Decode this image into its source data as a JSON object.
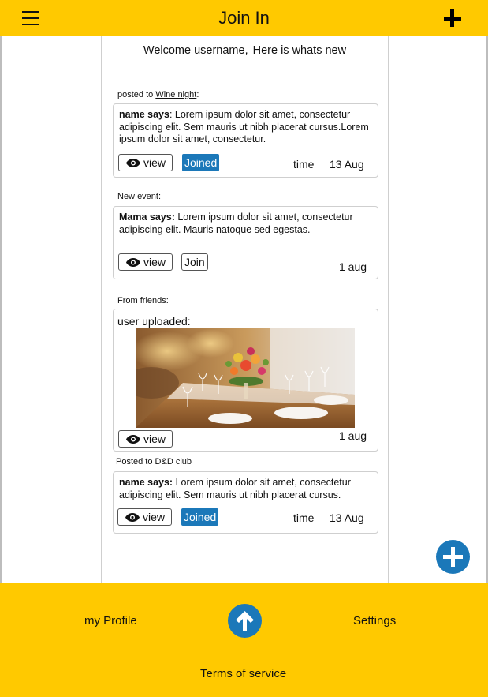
{
  "header": {
    "title": "Join In"
  },
  "feed": {
    "welcome_line1": "Welcome username,",
    "welcome_line2": "Here is whats new",
    "posts": [
      {
        "caption_prefix": "posted to ",
        "caption_link": "Wine night",
        "caption_suffix": ":",
        "author": "name says",
        "text": ": Lorem ipsum dolor sit amet, consectetur adipiscing elit. Sem mauris ut nibh placerat cursus.Lorem ipsum dolor sit amet, consectetur.",
        "view_label": "view",
        "join_label": "Joined",
        "time_label": "time",
        "date": "13 Aug"
      },
      {
        "caption_prefix": "New ",
        "caption_link": "event",
        "caption_suffix": ":",
        "author": "Mama says:",
        "text": " Lorem ipsum dolor sit amet, consectetur adipiscing elit. Mauris natoque sed egestas.",
        "view_label": "view",
        "join_label": "Join",
        "date": "1 aug"
      },
      {
        "caption": "From friends:",
        "title": "user uploaded:",
        "view_label": "view",
        "date": "1 aug"
      },
      {
        "caption": "Posted to D&D club",
        "author": "name says:",
        "text": " Lorem ipsum dolor sit amet, consectetur adipiscing elit. Sem mauris ut nibh placerat cursus.",
        "view_label": "view",
        "join_label": "Joined",
        "time_label": "time",
        "date": "13 Aug"
      }
    ]
  },
  "footer": {
    "profile": "my Profile",
    "settings": "Settings",
    "terms": "Terms of service"
  },
  "icons": {
    "menu": "hamburger-menu-icon",
    "add": "plus-icon",
    "view": "eye-icon",
    "fab": "add-circle-icon",
    "scroll_top": "arrow-up-icon"
  },
  "colors": {
    "brand_yellow": "#FFC900",
    "accent_blue": "#1B78B9"
  }
}
